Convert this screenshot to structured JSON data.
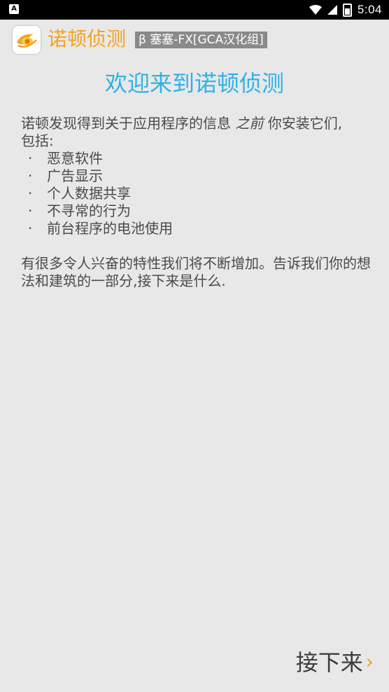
{
  "status_bar": {
    "notification_icon": "android-notification-icon",
    "time": "5:04"
  },
  "header": {
    "app_title": "诺顿侦测",
    "beta_badge": "β 塞塞-FX[GCA汉化组]"
  },
  "main": {
    "welcome_title": "欢迎来到诺顿侦测",
    "intro_before": "诺顿发现得到关于应用程序的信息 ",
    "intro_emphasis": "之前",
    "intro_after": " 你安装它们,",
    "intro_line2": "包括:",
    "features": [
      "恶意软件",
      "广告显示",
      "个人数据共享",
      "不寻常的行为",
      "前台程序的电池使用"
    ],
    "closing": "有很多令人兴奋的特性我们将不断增加。告诉我们你的想法和建筑的一部分,接下来是什么."
  },
  "footer": {
    "next_label": "接下来",
    "next_icon": "chevron-right-icon"
  },
  "colors": {
    "background": "#e8e8e8",
    "accent_orange": "#f4a21f",
    "title_blue": "#2fb1e8",
    "text": "#4a4a4a"
  }
}
